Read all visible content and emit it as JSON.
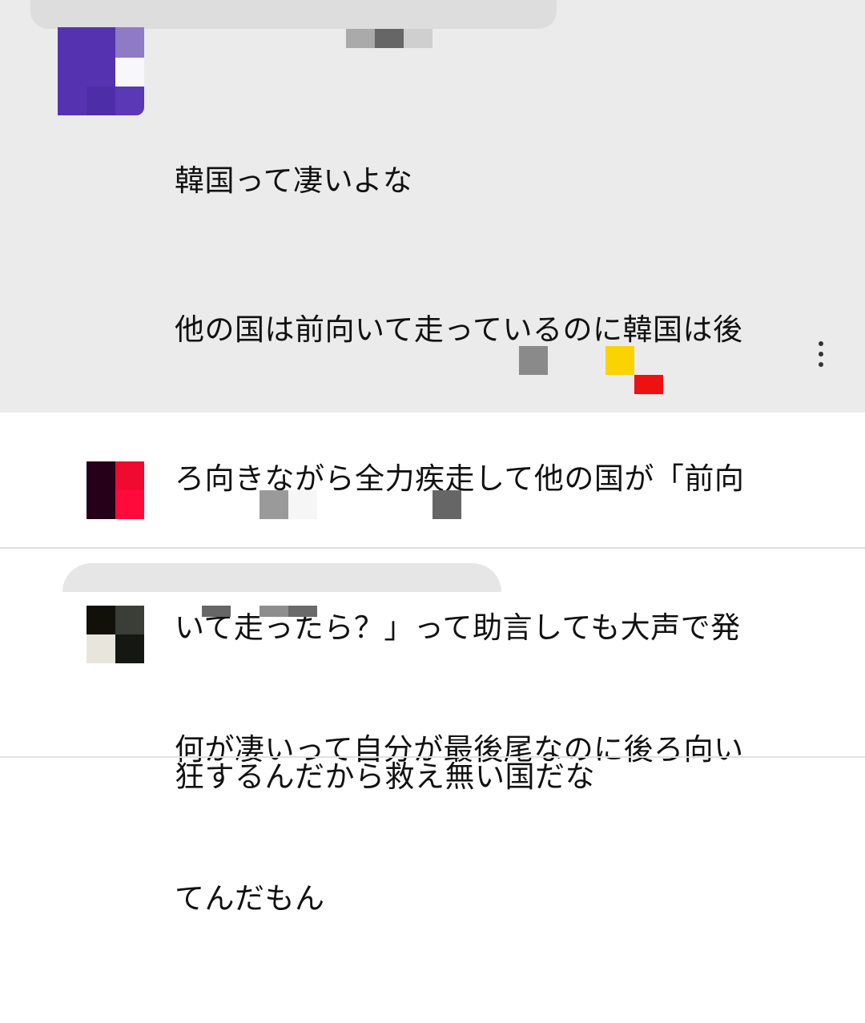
{
  "comments": [
    {
      "lines": [
        "韓国って凄いよな",
        "他の国は前向いて走っているのに韓国は後",
        "ろ向きながら全力疾走して他の国が「前向",
        "いて走ったら？」って助言しても大声で発",
        "狂するんだから救え無い国だな"
      ],
      "avatar_color": "#5a35b8",
      "more_icon": "more-vert-icon"
    },
    {
      "avatar_color": "#1a0010"
    },
    {
      "lines": [
        "何が凄いって自分が最後尾なのに後ろ向い",
        "てんだもん"
      ],
      "avatar_color": "#1a1a14"
    }
  ],
  "colors": {
    "highlight_bg": "#ebebeb",
    "divider": "#e0e0e0",
    "text": "#111111"
  }
}
